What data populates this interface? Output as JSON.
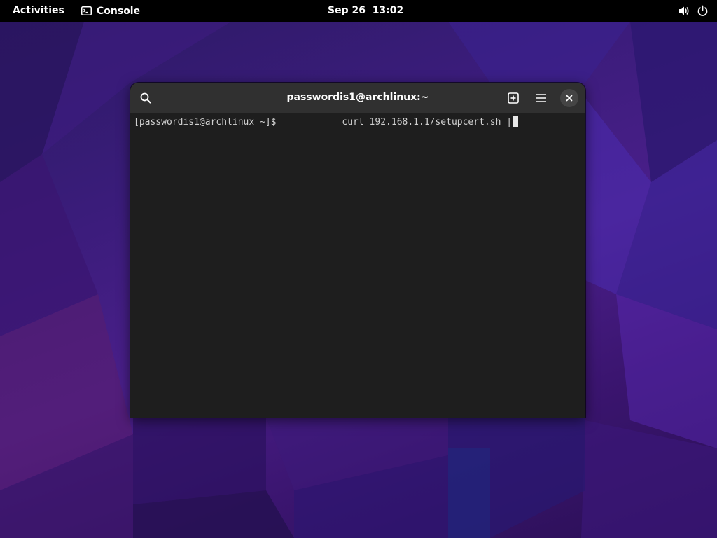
{
  "topbar": {
    "activities_label": "Activities",
    "app_name": "Console",
    "app_icon": "terminal-icon",
    "clock": "Sep 26  13:02",
    "status_icons": [
      "volume-icon",
      "power-icon"
    ]
  },
  "window": {
    "title": "passwordis1@archlinux:~",
    "buttons": [
      "search-icon",
      "new-tab-icon",
      "menu-icon",
      "close-icon"
    ]
  },
  "terminal": {
    "prompt": "[passwordis1@archlinux ~]$",
    "command": "curl 192.168.1.1/setupcert.sh |"
  },
  "colors": {
    "topbar_bg": "#000000",
    "headerbar_bg": "#303030",
    "terminal_bg": "#1e1e1e",
    "terminal_fg": "#d0d0d0",
    "wallpaper_accent": "#4a1f8a"
  }
}
